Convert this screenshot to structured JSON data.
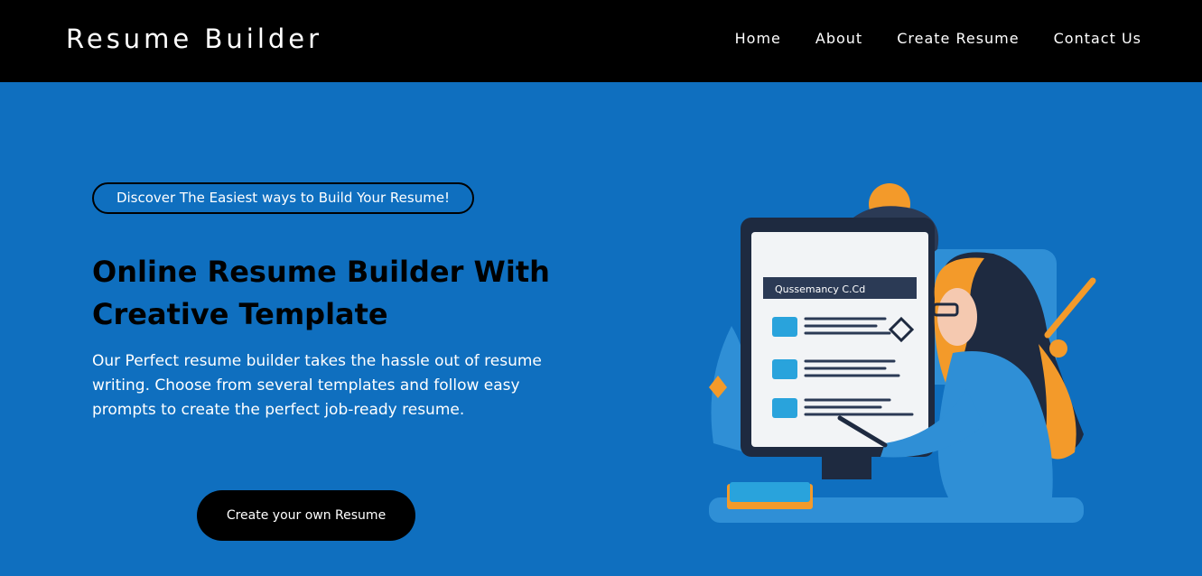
{
  "navbar": {
    "brand": "Resume Builder",
    "links": [
      {
        "label": "Home"
      },
      {
        "label": "About"
      },
      {
        "label": "Create Resume"
      },
      {
        "label": "Contact Us"
      }
    ]
  },
  "hero": {
    "tagline": "Discover The Easiest ways to Build Your Resume!",
    "headline": "Online Resume Builder With Creative Template",
    "description": "Our Perfect resume builder takes the hassle out of resume writing. Choose from several templates and follow easy prompts to create the perfect job-ready resume.",
    "cta_label": "Create your own Resume",
    "illustration": {
      "icon": "resume-illustration-icon",
      "document_title": "Qussemancy C.Cd"
    }
  },
  "colors": {
    "navbar_bg": "#000000",
    "hero_bg": "#0f6fbf",
    "accent_orange": "#f39a2a",
    "dark_navy": "#2b3a55",
    "screen_cyan": "#29a3dc",
    "text_white": "#ffffff",
    "text_black": "#000000"
  }
}
